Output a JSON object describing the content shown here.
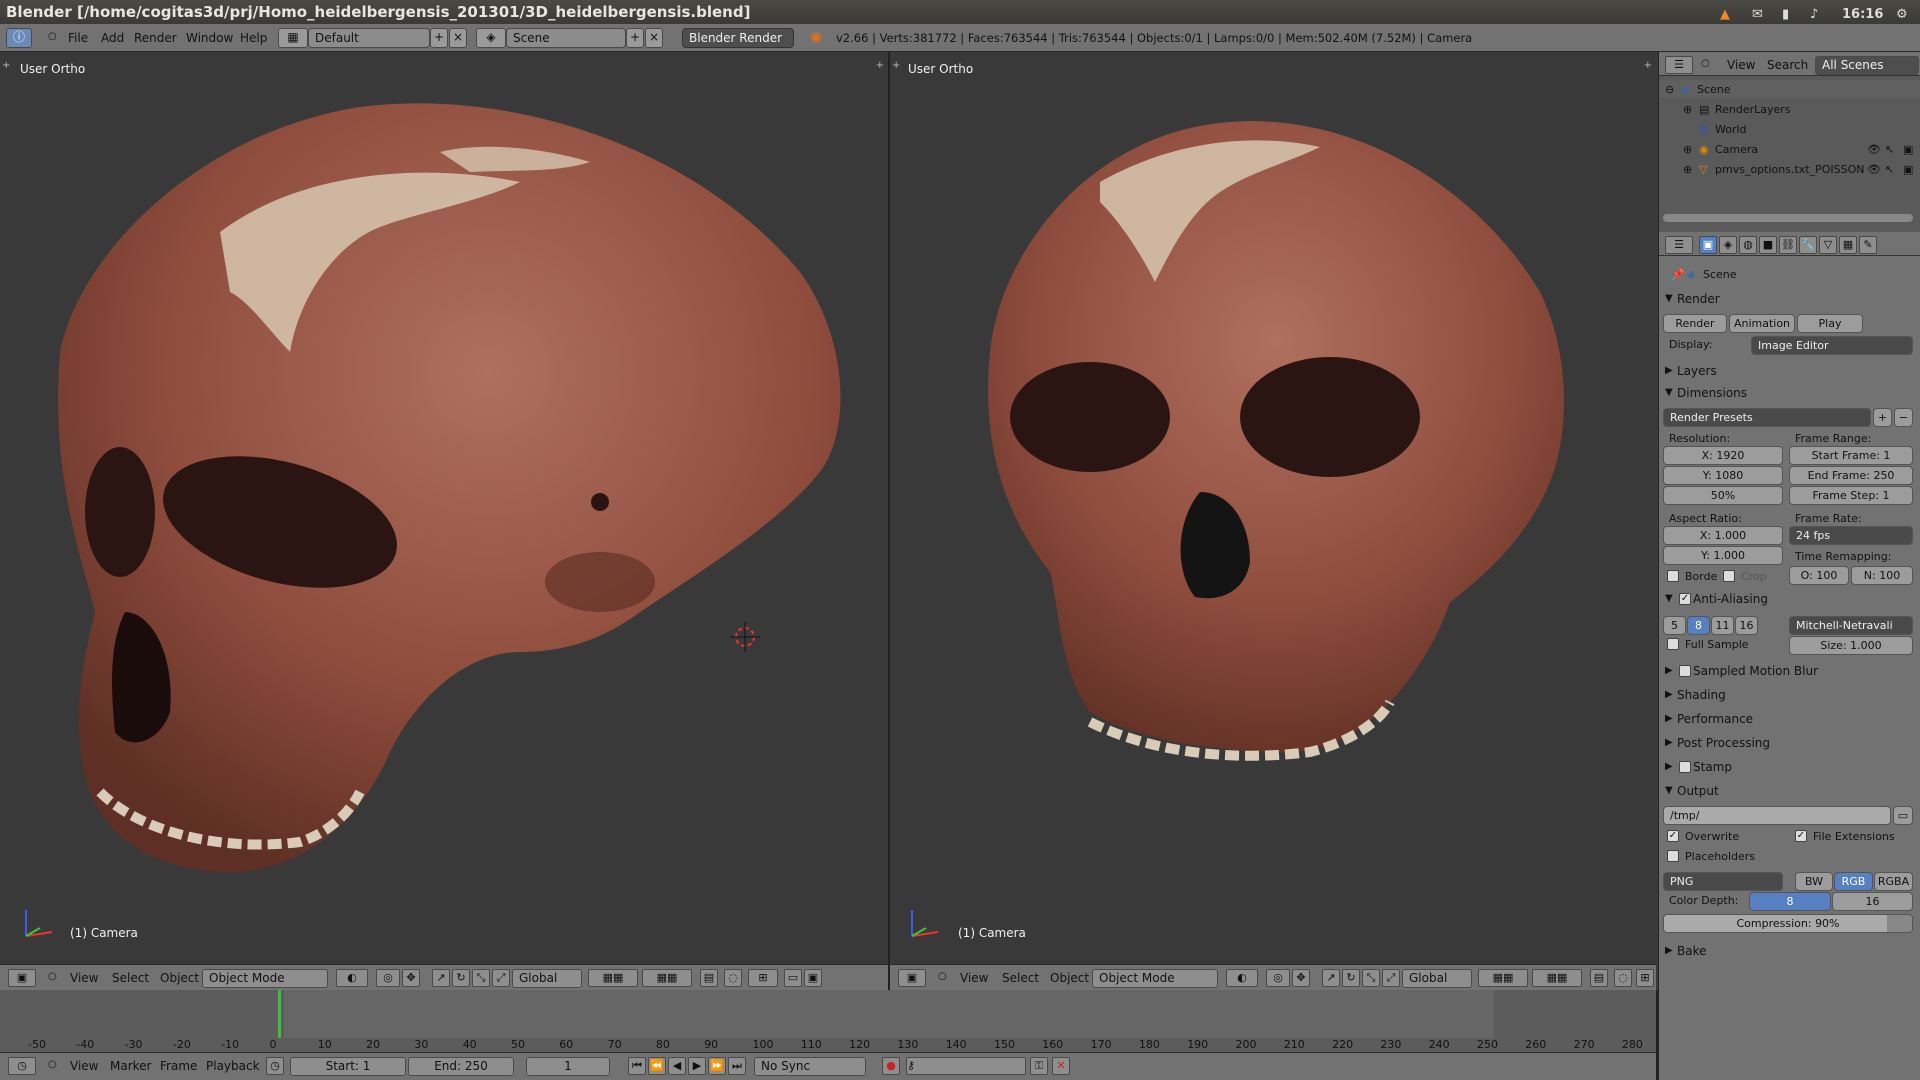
{
  "os_bar": {
    "title": "Blender [/home/cogitas3d/prj/Homo_heidelbergensis_201301/3D_heidelbergensis.blend]",
    "clock": "16:16"
  },
  "info_header": {
    "menus": [
      "File",
      "Add",
      "Render",
      "Window",
      "Help"
    ],
    "layout": "Default",
    "scene": "Scene",
    "engine": "Blender Render",
    "stats": "v2.66 | Verts:381772 | Faces:763544 | Tris:763544 | Objects:0/1 | Lamps:0/0 | Mem:502.40M (7.52M) | Camera"
  },
  "viewport_left": {
    "title": "User Ortho",
    "object_label": "(1) Camera"
  },
  "viewport_right": {
    "title": "User Ortho",
    "object_label": "(1) Camera"
  },
  "view3d_header": {
    "menus": [
      "View",
      "Select",
      "Object"
    ],
    "mode": "Object Mode",
    "orientation": "Global"
  },
  "timeline": {
    "ticks": [
      "-50",
      "-40",
      "-30",
      "-20",
      "-10",
      "0",
      "10",
      "20",
      "30",
      "40",
      "50",
      "60",
      "70",
      "80",
      "90",
      "100",
      "110",
      "120",
      "130",
      "140",
      "150",
      "160",
      "170",
      "180",
      "190",
      "200",
      "210",
      "220",
      "230",
      "240",
      "250",
      "260",
      "270",
      "280"
    ],
    "current_frame_fraction": 0.0,
    "menus": [
      "View",
      "Marker",
      "Frame",
      "Playback"
    ],
    "start": "Start: 1",
    "end": "End: 250",
    "frame": "1",
    "sync": "No Sync"
  },
  "outliner": {
    "menus": [
      "View",
      "Search"
    ],
    "filter": "All Scenes",
    "items": [
      "Scene",
      "RenderLayers",
      "World",
      "Camera",
      "pmvs_options.txt_POISSON"
    ]
  },
  "properties": {
    "context": "Scene",
    "render_panel": "Render",
    "render_buttons": [
      "Render",
      "Animation",
      "Play"
    ],
    "display_label": "Display:",
    "display_value": "Image Editor",
    "layers": "Layers",
    "dimensions": "Dimensions",
    "render_presets": "Render Presets",
    "resolution_label": "Resolution:",
    "res_x": "X: 1920",
    "res_y": "Y: 1080",
    "res_pct": "50%",
    "aspect_label": "Aspect Ratio:",
    "aspect_x": "X: 1.000",
    "aspect_y": "Y: 1.000",
    "border": "Borde",
    "crop": "Crop",
    "frame_range_label": "Frame Range:",
    "start_frame": "Start Frame: 1",
    "end_frame": "End Frame: 250",
    "frame_step": "Frame Step: 1",
    "frame_rate_label": "Frame Rate:",
    "frame_rate": "24 fps",
    "time_remap_label": "Time Remapping:",
    "remap_o": "O: 100",
    "remap_n": "N: 100",
    "anti_aliasing": "Anti-Aliasing",
    "aa_samples": [
      "5",
      "8",
      "11",
      "16"
    ],
    "aa_selected": "8",
    "aa_filter": "Mitchell-Netravali",
    "full_sample": "Full Sample",
    "aa_size": "Size: 1.000",
    "collapsed_panels": [
      "Sampled Motion Blur",
      "Shading",
      "Performance",
      "Post Processing",
      "Stamp"
    ],
    "output": "Output",
    "output_path": "/tmp/",
    "overwrite": "Overwrite",
    "file_extensions": "File Extensions",
    "placeholders": "Placeholders",
    "format": "PNG",
    "color_modes": [
      "BW",
      "RGB",
      "RGBA"
    ],
    "color_mode_selected": "RGB",
    "color_depth_label": "Color Depth:",
    "depths": [
      "8",
      "16"
    ],
    "depth_selected": "8",
    "compression": "Compression: 90%",
    "bake": "Bake"
  },
  "colors": {
    "bone_dark": "#6b3528",
    "bone_mid": "#8e4c3d",
    "bone_light": "#a86352",
    "plaster": "#d7c7b0",
    "selection_blue": "#5680c2",
    "frame_green": "#3fbf3f"
  }
}
